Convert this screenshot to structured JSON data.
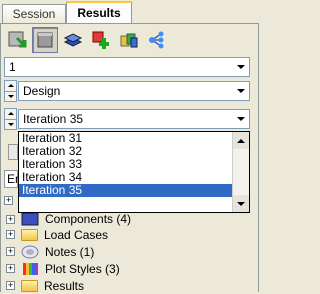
{
  "tabs": [
    {
      "label": "Session"
    },
    {
      "label": "Results"
    }
  ],
  "toolbar": {
    "buttons": [
      {
        "icon": "load-results-icon"
      },
      {
        "icon": "gray-box-icon"
      },
      {
        "icon": "layer-icon"
      },
      {
        "icon": "cube-plus-icon"
      },
      {
        "icon": "multi-cube-icon"
      },
      {
        "icon": "network-icon"
      }
    ]
  },
  "combos": {
    "first": {
      "value": "1"
    },
    "second": {
      "value": "Design"
    },
    "third": {
      "value": "Iteration 35"
    }
  },
  "iterations": {
    "options": [
      "Iteration 31",
      "Iteration 32",
      "Iteration 33",
      "Iteration 34",
      "Iteration 35"
    ],
    "selected": "Iteration 35"
  },
  "partial": {
    "entity_header": "En"
  },
  "tree": {
    "items": [
      {
        "label": "Components (4)",
        "icon": "components-icon"
      },
      {
        "label": "Load Cases",
        "icon": "folder-icon"
      },
      {
        "label": "Notes (1)",
        "icon": "notes-icon"
      },
      {
        "label": "Plot Styles (3)",
        "icon": "plot-styles-icon"
      },
      {
        "label": "Results",
        "icon": "folder-icon"
      }
    ]
  },
  "colors": {
    "selection": "#316ac5",
    "tab_highlight": "#ffc83c",
    "background": "#ece9d8"
  }
}
